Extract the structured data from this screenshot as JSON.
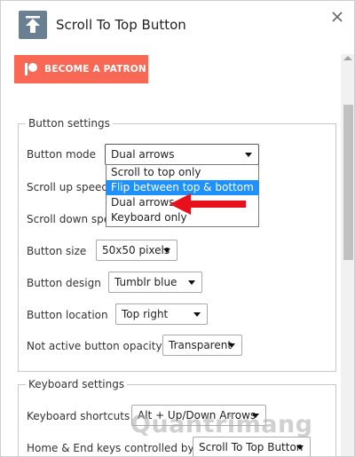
{
  "header": {
    "title": "Scroll To Top Button",
    "icon": "upload-arrow-icon",
    "close_icon": "close-icon"
  },
  "patron": {
    "label": "BECOME A PATRON",
    "color": "#f96854",
    "icon": "patreon-icon"
  },
  "button_settings": {
    "legend": "Button settings",
    "button_mode": {
      "label": "Button mode",
      "value": "Dual arrows",
      "options": [
        "Scroll to top only",
        "Flip between top & bottom",
        "Dual arrows",
        "Keyboard only"
      ],
      "highlighted": "Flip between top & bottom"
    },
    "scroll_up_speed": {
      "label": "Scroll up speed"
    },
    "scroll_down_speed": {
      "label": "Scroll down spee"
    },
    "button_size": {
      "label": "Button size",
      "value": "50x50 pixels"
    },
    "button_design": {
      "label": "Button design",
      "value": "Tumblr blue"
    },
    "button_location": {
      "label": "Button location",
      "value": "Top right"
    },
    "not_active_opacity": {
      "label": "Not active button opacity",
      "value": "Transparent"
    }
  },
  "keyboard_settings": {
    "legend": "Keyboard settings",
    "shortcuts": {
      "label": "Keyboard shortcuts",
      "value": "Alt + Up/Down Arrows"
    },
    "home_end": {
      "label": "Home & End keys controlled by",
      "value": "Scroll To Top Button"
    }
  },
  "annotation": {
    "color": "#e8101a"
  },
  "watermark": "Quantrimang"
}
